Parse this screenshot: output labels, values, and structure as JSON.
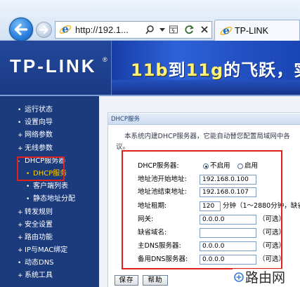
{
  "browser": {
    "url": "http://192.1...",
    "tab_title": "TP-LINK",
    "icons": [
      "back-arrow-icon",
      "forward-arrow-icon",
      "ie-page-icon",
      "search-icon",
      "dropdown-arrow-icon",
      "compatibility-view-icon",
      "refresh-icon",
      "stop-icon"
    ]
  },
  "header": {
    "logo": "TP-LINK",
    "logo_mark": "®",
    "banner": [
      "11b",
      "到",
      "11g",
      "的飞跃，实"
    ]
  },
  "sidebar": {
    "items": [
      {
        "bullet": "•",
        "label": "运行状态"
      },
      {
        "bullet": "•",
        "label": "设置向导"
      },
      {
        "bullet": "+",
        "label": "网络参数"
      },
      {
        "bullet": "+",
        "label": "无线参数"
      },
      {
        "bullet": "-",
        "label": "DHCP服务器"
      },
      {
        "bullet": "•",
        "label": "DHCP服务",
        "active": true
      },
      {
        "bullet": "•",
        "label": "客户端列表"
      },
      {
        "bullet": "•",
        "label": "静态地址分配"
      },
      {
        "bullet": "+",
        "label": "转发规则"
      },
      {
        "bullet": "+",
        "label": "安全设置"
      },
      {
        "bullet": "+",
        "label": "路由功能"
      },
      {
        "bullet": "+",
        "label": "IP与MAC绑定"
      },
      {
        "bullet": "•",
        "label": "动态DNS"
      },
      {
        "bullet": "+",
        "label": "系统工具"
      }
    ]
  },
  "panel": {
    "title": "DHCP服务",
    "intro_line1": "本系统内建DHCP服务器，它能自动替您配置局域网中各",
    "intro_line2": "议。"
  },
  "form": {
    "dhcp_server": {
      "label": "DHCP服务器:",
      "options": [
        {
          "label": "不启用",
          "checked": true
        },
        {
          "label": "启用",
          "checked": false
        }
      ]
    },
    "start_ip": {
      "label": "地址池开始地址:",
      "value": "192.168.0.100"
    },
    "end_ip": {
      "label": "地址池结束地址:",
      "value": "192.168.0.107"
    },
    "lease": {
      "label": "地址租期:",
      "value": "120",
      "hint": "分钟（1～2880分钟，缺省"
    },
    "gateway": {
      "label": "网关:",
      "value": "0.0.0.0",
      "hint": "（可选）"
    },
    "domain": {
      "label": "缺省域名:",
      "value": "",
      "hint": "（可选）"
    },
    "primary_dns": {
      "label": "主DNS服务器:",
      "value": "0.0.0.0",
      "hint": "（可选）"
    },
    "secondary_dns": {
      "label": "备用DNS服务器:",
      "value": "0.0.0.0",
      "hint": "（可选）"
    }
  },
  "buttons": {
    "save": "保存",
    "help": "帮助"
  },
  "watermark": "路由网",
  "colors": {
    "sidebar_bg": "#1c3b7c",
    "header_bg": "#1d3f8e",
    "active_menu": "#ffcc00",
    "annotation_red": "#e0201b",
    "banner_highlight": "#fff27a"
  }
}
